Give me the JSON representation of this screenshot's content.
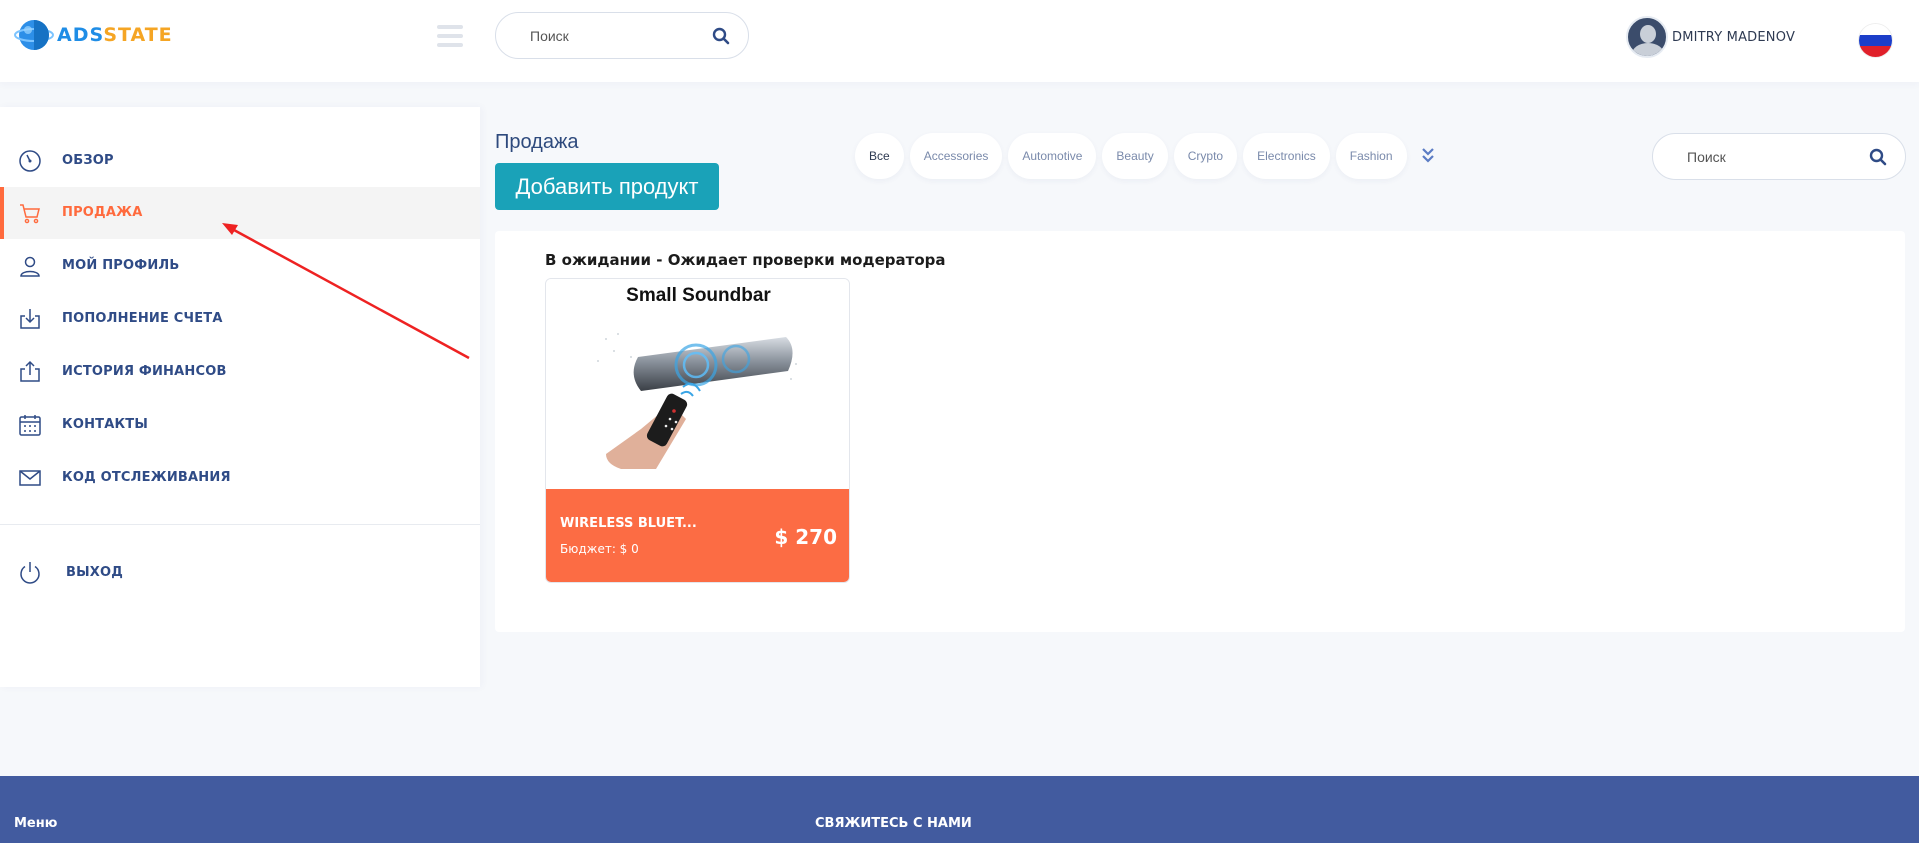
{
  "header": {
    "logo_part1": "ADS",
    "logo_part2": "STATE",
    "search_placeholder": "Поиск",
    "user_name": "DMITRY MADENOV",
    "flag_colors": [
      "#ffffff",
      "#1c3ec9",
      "#e0202a"
    ]
  },
  "sidebar": {
    "items": [
      {
        "label": "ОБЗОР",
        "icon": "dashboard-icon"
      },
      {
        "label": "ПРОДАЖА",
        "icon": "cart-icon"
      },
      {
        "label": "МОЙ ПРОФИЛЬ",
        "icon": "user-icon"
      },
      {
        "label": "ПОПОЛНЕНИЕ СЧЕТА",
        "icon": "download-icon"
      },
      {
        "label": "ИСТОРИЯ ФИНАНСОВ",
        "icon": "upload-icon"
      },
      {
        "label": "КОНТАКТЫ",
        "icon": "calendar-icon"
      },
      {
        "label": "КОД ОТСЛЕЖИВАНИЯ",
        "icon": "envelope-icon"
      }
    ],
    "logout_label": "ВЫХОД",
    "active_color": "#ff6a3d"
  },
  "main": {
    "title": "Продажа",
    "add_button": "Добавить продукт",
    "categories": [
      "Все",
      "Accessories",
      "Automotive",
      "Beauty",
      "Crypto",
      "Electronics",
      "Fashion"
    ],
    "search_placeholder": "Поиск",
    "section_title": "В ожидании - Ожидает проверки модератора",
    "card": {
      "image_title": "Small  Soundbar",
      "name": "WIRELESS BLUET...",
      "budget": "Бюджет: $ 0",
      "price": "$ 270",
      "accent": "#fc6c44"
    }
  },
  "footer": {
    "menu_label": "Меню",
    "contact_label": "СВЯЖИТЕСЬ С НАМИ",
    "bg": "#425b9f"
  }
}
